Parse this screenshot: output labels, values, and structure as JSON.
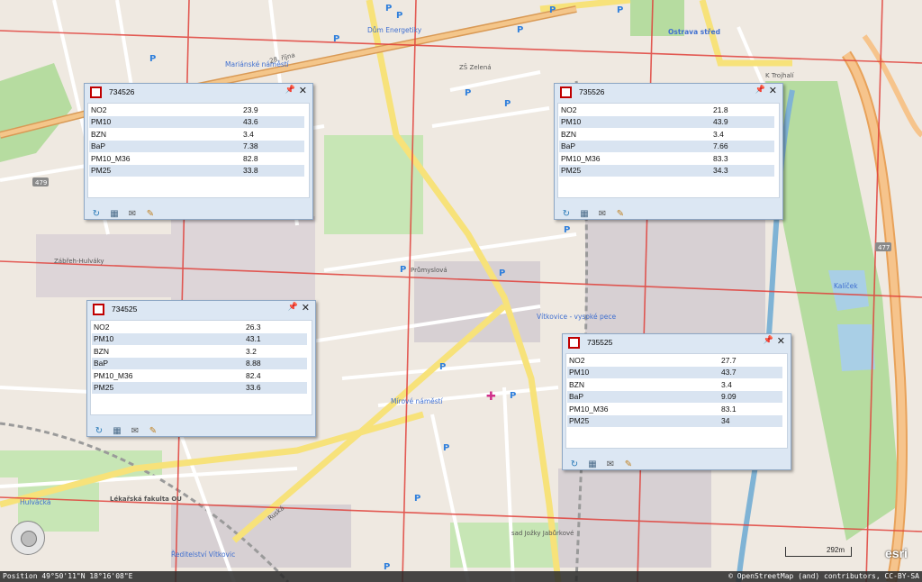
{
  "map": {
    "labels": {
      "dum_energetiky": "Dům Energetiky",
      "ostrava_stred": "Ostrava střed",
      "marianske_namesti": "Mariánské náměstí",
      "zabreh_hulvaky": "Zábřeh-Hulváky",
      "vitkovice_vysoke_pece": "Vítkovice - vysoké pece",
      "mirove_namesti": "Mírové náměstí",
      "hulvacka": "Hulvácká",
      "lekarska_fakulta": "Lékařská fakulta OU",
      "reditelstvi_vitkovic": "Ředitelství Vítkovic",
      "sad_jozky": "sad Jožky Jabůrkové",
      "road_28_rijna": "28. října",
      "road_479": "479",
      "road_477": "477",
      "zs_zelena": "ZŠ Zelená",
      "k_trojhali": "K Trojhalí",
      "prumyslova": "Průmyslová",
      "ruska": "Ruská",
      "kalicek": "Kalíček"
    },
    "parking_symbol": "P"
  },
  "popups": [
    {
      "id": "734526",
      "rows": [
        {
          "name": "NO2",
          "value": "23.9"
        },
        {
          "name": "PM10",
          "value": "43.6"
        },
        {
          "name": "BZN",
          "value": "3.4"
        },
        {
          "name": "BaP",
          "value": "7.38"
        },
        {
          "name": "PM10_M36",
          "value": "82.8"
        },
        {
          "name": "PM25",
          "value": "33.8"
        }
      ]
    },
    {
      "id": "735526",
      "rows": [
        {
          "name": "NO2",
          "value": "21.8"
        },
        {
          "name": "PM10",
          "value": "43.9"
        },
        {
          "name": "BZN",
          "value": "3.4"
        },
        {
          "name": "BaP",
          "value": "7.66"
        },
        {
          "name": "PM10_M36",
          "value": "83.3"
        },
        {
          "name": "PM25",
          "value": "34.3"
        }
      ]
    },
    {
      "id": "734525",
      "rows": [
        {
          "name": "NO2",
          "value": "26.3"
        },
        {
          "name": "PM10",
          "value": "43.1"
        },
        {
          "name": "BZN",
          "value": "3.2"
        },
        {
          "name": "BaP",
          "value": "8.88"
        },
        {
          "name": "PM10_M36",
          "value": "82.4"
        },
        {
          "name": "PM25",
          "value": "33.6"
        }
      ]
    },
    {
      "id": "735525",
      "rows": [
        {
          "name": "NO2",
          "value": "27.7"
        },
        {
          "name": "PM10",
          "value": "43.7"
        },
        {
          "name": "BZN",
          "value": "3.4"
        },
        {
          "name": "BaP",
          "value": "9.09"
        },
        {
          "name": "PM10_M36",
          "value": "83.1"
        },
        {
          "name": "PM25",
          "value": "34"
        }
      ]
    }
  ],
  "popup_icons": [
    "zoom-to-icon",
    "map-layers-icon",
    "email-icon",
    "edit-pencil-icon"
  ],
  "status": {
    "position": "Position 49°50'11\"N 18°16'08\"E",
    "attribution": "© OpenStreetMap (and) contributors, CC-BY-SA"
  },
  "scale": {
    "label": "292m"
  },
  "logo": {
    "text": "esri"
  },
  "colors": {
    "grid_line": "#e0403a",
    "popup_header": "#dce7f3",
    "popup_row_alt": "#d9e4f1",
    "road_yellow": "#f7e27a",
    "green_area": "#b6dca0",
    "river": "#7fb3d5"
  }
}
